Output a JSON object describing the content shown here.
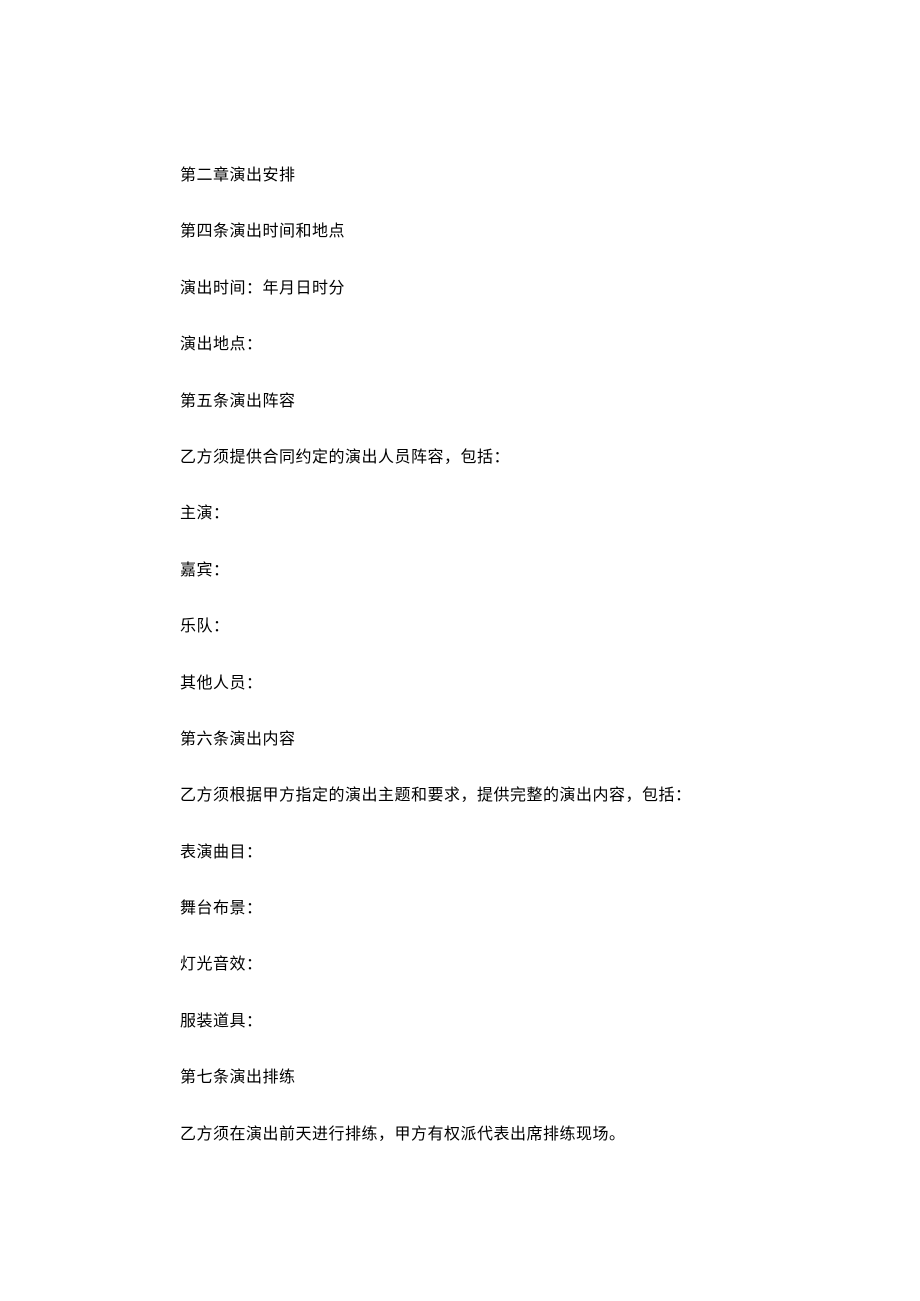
{
  "paragraphs": [
    "第二章演出安排",
    "第四条演出时间和地点",
    "演出时间：年月日时分",
    "演出地点：",
    "第五条演出阵容",
    "乙方须提供合同约定的演出人员阵容，包括：",
    "主演：",
    "嘉宾：",
    "乐队：",
    "其他人员：",
    "第六条演出内容",
    "乙方须根据甲方指定的演出主题和要求，提供完整的演出内容，包括：",
    "表演曲目：",
    "舞台布景：",
    "灯光音效：",
    "服装道具：",
    "第七条演出排练",
    "乙方须在演出前天进行排练，甲方有权派代表出席排练现场。"
  ]
}
